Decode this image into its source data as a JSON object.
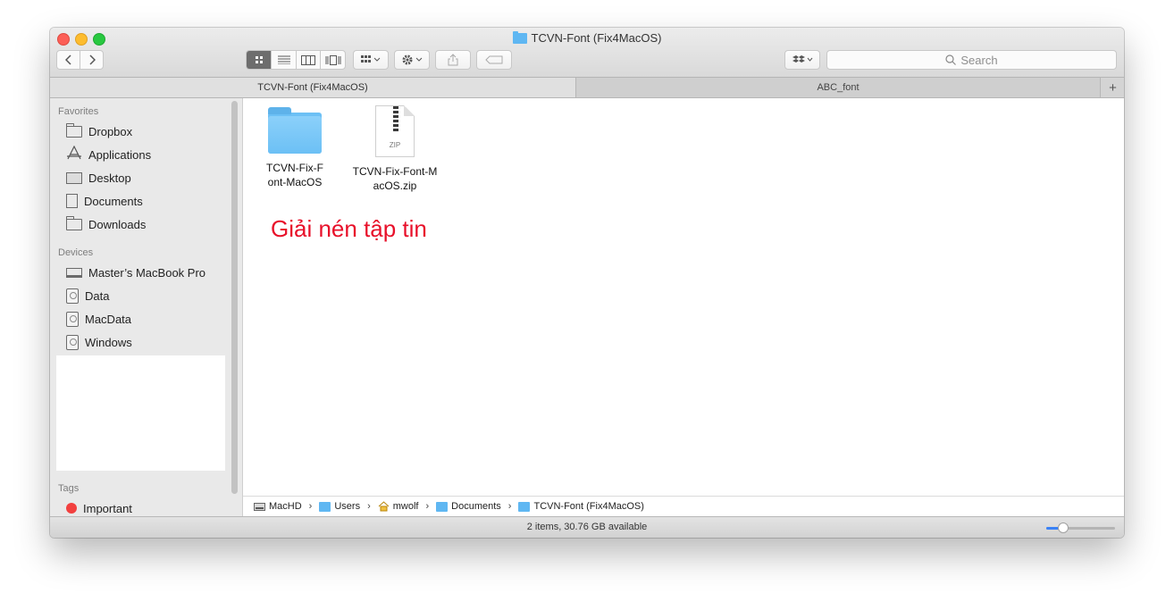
{
  "window": {
    "title": "TCVN-Font (Fix4MacOS)"
  },
  "toolbar": {
    "back_icon": "chevron-left-icon",
    "forward_icon": "chevron-right-icon",
    "view_modes": [
      "icon-view-icon",
      "list-view-icon",
      "column-view-icon",
      "cover-flow-icon"
    ],
    "active_view": "icon-view-icon",
    "search_placeholder": "Search"
  },
  "tabs": [
    {
      "label": "TCVN-Font (Fix4MacOS)",
      "active": true
    },
    {
      "label": "ABC_font",
      "active": false
    }
  ],
  "tab_add_label": "+",
  "sidebar": {
    "favorites_heading": "Favorites",
    "favorites": [
      {
        "label": "Dropbox",
        "icon": "folder-icon"
      },
      {
        "label": "Applications",
        "icon": "applications-icon"
      },
      {
        "label": "Desktop",
        "icon": "desktop-icon"
      },
      {
        "label": "Documents",
        "icon": "documents-icon"
      },
      {
        "label": "Downloads",
        "icon": "folder-icon"
      }
    ],
    "devices_heading": "Devices",
    "devices": [
      {
        "label": "Master’s MacBook Pro",
        "icon": "laptop-icon"
      },
      {
        "label": "Data",
        "icon": "disk-icon"
      },
      {
        "label": "MacData",
        "icon": "disk-icon"
      },
      {
        "label": "Windows",
        "icon": "disk-icon"
      }
    ],
    "tags_heading": "Tags",
    "tags": [
      {
        "label": "Important",
        "color": "#f2403f"
      }
    ]
  },
  "files": [
    {
      "name": "TCVN-Fix-Font-MacOS",
      "kind": "folder"
    },
    {
      "name": "TCVN-Fix-Font-MacOS.zip",
      "kind": "zip",
      "badge": "ZIP"
    }
  ],
  "annotation": {
    "text": "Giải nén tập tin",
    "color": "#e8102a"
  },
  "path": [
    {
      "label": "MacHD",
      "icon": "hard-drive-icon"
    },
    {
      "label": "Users",
      "icon": "users-folder-icon"
    },
    {
      "label": "mwolf",
      "icon": "home-icon"
    },
    {
      "label": "Documents",
      "icon": "documents-folder-icon"
    },
    {
      "label": "TCVN-Font (Fix4MacOS)",
      "icon": "folder-icon"
    }
  ],
  "path_separator": "›",
  "status": {
    "text": "2 items, 30.76 GB available",
    "zoom_level": 0.25
  },
  "colors": {
    "accent": "#3b82f6",
    "folder": "#6cc0f5",
    "close": "#fc5f57",
    "minimize": "#fdbc2e",
    "maximize": "#28c840"
  }
}
